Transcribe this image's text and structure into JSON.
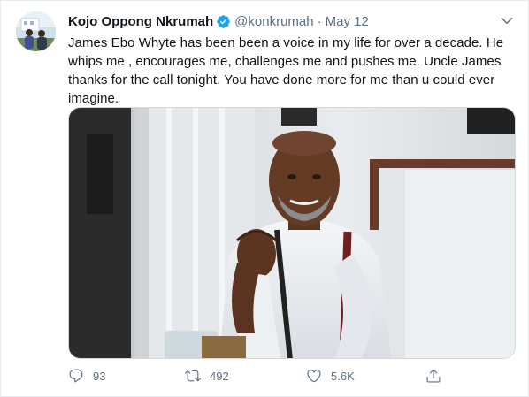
{
  "tweet": {
    "author_name": "Kojo Oppong Nkrumah",
    "handle": "@konkrumah",
    "separator": "·",
    "date": "May 12",
    "text_lines": [
      "James Ebo Whyte has been been a voice in my life for over a decade. He",
      "whips me , encourages me, challenges me and pushes me. Uncle James",
      "thanks for the call tonight. You have done more for me than u could ever",
      "imagine."
    ]
  },
  "actions": {
    "reply": {
      "icon": "reply-icon",
      "count": "93"
    },
    "retweet": {
      "icon": "retweet-icon",
      "count": "492"
    },
    "like": {
      "icon": "heart-icon",
      "count": "5.6K"
    },
    "share": {
      "icon": "share-icon"
    }
  },
  "colors": {
    "verified": "#1da1f2",
    "secondary_text": "#5b7083",
    "primary_text": "#0f1419"
  }
}
